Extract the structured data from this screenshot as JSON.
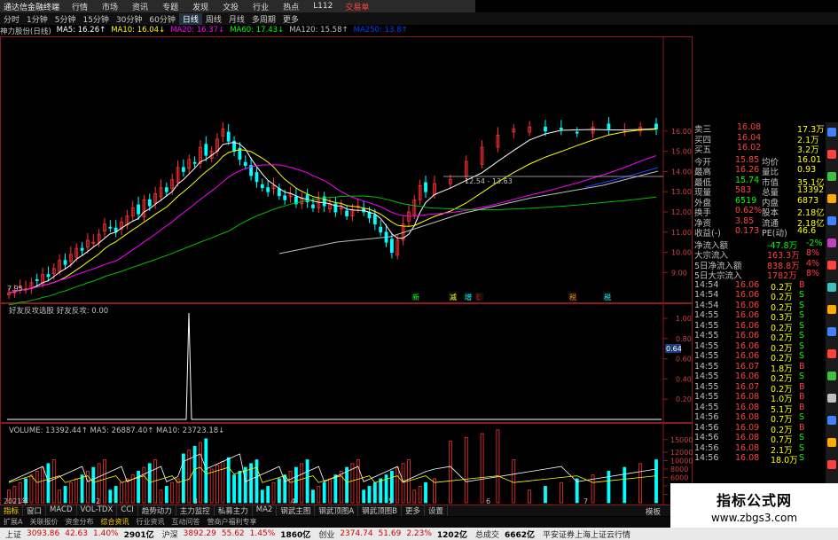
{
  "menubar": {
    "app_title": "通达信金融终端",
    "items": [
      "行情",
      "市场",
      "资讯",
      "专题",
      "发现",
      "文投",
      "行业",
      "热点",
      "L112"
    ],
    "right_label": "交易单"
  },
  "timeframes": [
    "分时",
    "1分钟",
    "5分钟",
    "15分钟",
    "30分钟",
    "60分钟",
    "日线",
    "周线",
    "月线",
    "多周期",
    "更多"
  ],
  "active_timeframe": "日线",
  "ma_line": [
    {
      "label": "神力股份(日线)",
      "color": "#cccccc"
    },
    {
      "label": "MA5: 16.26↑",
      "color": "#ffffff"
    },
    {
      "label": "MA10: 16.04↓",
      "color": "#ffff00"
    },
    {
      "label": "MA20: 16.37↓",
      "color": "#ff00ff"
    },
    {
      "label": "MA60: 17.43↓",
      "color": "#00ff00"
    },
    {
      "label": "MA120: 15.58↑",
      "color": "#c0c0c0"
    },
    {
      "label": "MA250: 13.8↑",
      "color": "#0040ff"
    }
  ],
  "price_axis": [
    "16.00",
    "15.00",
    "14.00",
    "13.00",
    "12.00",
    "11.00",
    "10.00",
    "9.00"
  ],
  "price_low_label": "7.95",
  "price_annotation": "12.54 - 13.63",
  "signal_labels": [
    {
      "text": "新",
      "color": "#00ff00"
    },
    {
      "text": "减",
      "color": "#ffff00"
    },
    {
      "text": "增",
      "color": "#00ffff"
    },
    {
      "text": "E",
      "color": "#ff0000"
    },
    {
      "text": "税",
      "color": "#ff8000"
    },
    {
      "text": "税",
      "color": "#00ffff"
    }
  ],
  "indicator": {
    "title": "好友反攻选股 好友反攻: 0.00",
    "axis": [
      "1.00",
      "0.80",
      "0.60",
      "0.40",
      "0.20"
    ],
    "marker": "0.64"
  },
  "volume": {
    "title": "VOLUME: 13392.44↑  MA5: 26887.40↑  MA10: 23723.18↓",
    "axis": [
      "15000",
      "12000",
      "10000",
      "8000",
      "6000",
      "4000",
      "2000"
    ],
    "year_label": "2021年"
  },
  "chart_data": {
    "type": "candlestick",
    "ylim": [
      8,
      16.3
    ],
    "x_ticks": [
      "2",
      "3",
      "4",
      "5",
      "6",
      "7"
    ],
    "ma_legend": [
      "MA5",
      "MA10",
      "MA20",
      "MA60",
      "MA120",
      "MA250"
    ]
  },
  "quote_panel": {
    "asks": [
      {
        "label": "卖三",
        "price": "16.08",
        "vol": "17.3万"
      },
      {
        "label": "买四",
        "price": "16.04",
        "vol": "2.1万"
      },
      {
        "label": "买五",
        "price": "16.02",
        "vol": "3.2万"
      }
    ],
    "stats": [
      {
        "l1": "今开",
        "v1": "15.85",
        "l2": "均价",
        "v2": "16.01"
      },
      {
        "l1": "最高",
        "v1": "16.26",
        "l2": "量比",
        "v2": "0.93"
      },
      {
        "l1": "最低",
        "v1": "15.74",
        "l2": "市值",
        "v2": "35.1亿"
      },
      {
        "l1": "现量",
        "v1": "583",
        "l2": "总量",
        "v2": "13392"
      },
      {
        "l1": "外盘",
        "v1": "6519",
        "l2": "内盘",
        "v2": "6873"
      },
      {
        "l1": "换手",
        "v1": "0.62%",
        "l2": "股本",
        "v2": "2.18亿"
      },
      {
        "l1": "净资",
        "v1": "3.85",
        "l2": "流通",
        "v2": "2.18亿"
      },
      {
        "l1": "收益(-)",
        "v1": "0.173",
        "l2": "PE(动)",
        "v2": "46.6"
      }
    ],
    "flows": [
      {
        "label": "净流入额",
        "value": "-47.8万",
        "pct": "-2%"
      },
      {
        "label": "大宗流入",
        "value": "163.3万",
        "pct": "8%"
      },
      {
        "label": "5日净流入额",
        "value": "838.8万",
        "pct": "4%"
      },
      {
        "label": "5日大宗流入",
        "value": "1782万",
        "pct": "8%"
      }
    ],
    "ticks": [
      {
        "time": "14:54",
        "price": "16.06",
        "vol": "0.2万",
        "side": "B"
      },
      {
        "time": "14:54",
        "price": "16.06",
        "vol": "0.2万",
        "side": "S"
      },
      {
        "time": "14:54",
        "price": "16.06",
        "vol": "0.2万",
        "side": "S"
      },
      {
        "time": "14:55",
        "price": "16.06",
        "vol": "0.3万",
        "side": "S"
      },
      {
        "time": "14:55",
        "price": "16.06",
        "vol": "0.2万",
        "side": "S"
      },
      {
        "time": "14:55",
        "price": "16.06",
        "vol": "0.2万",
        "side": "S"
      },
      {
        "time": "14:55",
        "price": "16.06",
        "vol": "0.2万",
        "side": "S"
      },
      {
        "time": "14:55",
        "price": "16.06",
        "vol": "0.2万",
        "side": "S"
      },
      {
        "time": "14:55",
        "price": "16.07",
        "vol": "1.8万",
        "side": "B"
      },
      {
        "time": "14:55",
        "price": "16.06",
        "vol": "0.2万",
        "side": "S"
      },
      {
        "time": "14:55",
        "price": "16.07",
        "vol": "0.2万",
        "side": "B"
      },
      {
        "time": "14:55",
        "price": "16.08",
        "vol": "1.0万",
        "side": "B"
      },
      {
        "time": "14:55",
        "price": "16.08",
        "vol": "5.1万",
        "side": "B"
      },
      {
        "time": "14:56",
        "price": "16.08",
        "vol": "0.7万",
        "side": "S"
      },
      {
        "time": "14:56",
        "price": "16.09",
        "vol": "0.2万",
        "side": "B"
      },
      {
        "time": "14:56",
        "price": "16.08",
        "vol": "0.7万",
        "side": "S"
      },
      {
        "time": "14:56",
        "price": "16.08",
        "vol": "2.1万",
        "side": "S"
      },
      {
        "time": "14:56",
        "price": "16.08",
        "vol": "18.0万",
        "side": "S"
      }
    ]
  },
  "tabs": [
    "指标",
    "窗口",
    "MACD",
    "VOL-TDX",
    "CCI",
    "趋势动力",
    "主力监控",
    "私募主力",
    "MA2",
    "钢武主图",
    "钢武顶图A",
    "钢武顶图B",
    "更多",
    "设置"
  ],
  "active_tab": "指标",
  "subtabs": [
    "扩展A",
    "关联报价",
    "资金分布",
    "综合资讯",
    "行业资讯",
    "互动问答",
    "营商户福利专享"
  ],
  "right_tab": "模板",
  "statusbar": [
    {
      "label": "上证",
      "value": "3093.86",
      "chg": "42.63",
      "pct": "1.40%",
      "amt": "2901亿"
    },
    {
      "label": "沪深",
      "value": "3892.29",
      "chg": "55.62",
      "pct": "1.45%",
      "amt": "1860亿"
    },
    {
      "label": "创业",
      "value": "2374.74",
      "chg": "51.69",
      "pct": "2.23%",
      "amt": "1202亿"
    }
  ],
  "status_total_label": "总成交",
  "status_total_value": "6662亿",
  "status_broker": "平安证券上海上证云行情",
  "watermark": {
    "title": "指标公式网",
    "url": "www.zbgs3.com"
  }
}
